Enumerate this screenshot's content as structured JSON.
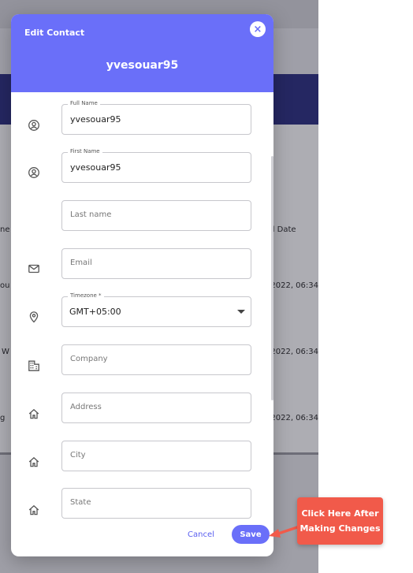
{
  "background": {
    "column_header": "ed Date",
    "col_left_1": "ne",
    "col_left_2": "ou",
    "col_left_3": "W",
    "col_left_4": "g",
    "rows": [
      "/2022, 06:34",
      "/2022, 06:34",
      "/2022, 06:34"
    ]
  },
  "modal": {
    "title": "Edit Contact",
    "contact_name": "yvesouar95",
    "close_symbol": "×"
  },
  "fields": {
    "full_name": {
      "label": "Full Name",
      "value": "yvesouar95"
    },
    "first_name": {
      "label": "First Name",
      "value": "yvesouar95"
    },
    "last_name": {
      "placeholder": "Last name"
    },
    "email": {
      "placeholder": "Email"
    },
    "timezone": {
      "label": "Timezone *",
      "value": "GMT+05:00"
    },
    "company": {
      "placeholder": "Company"
    },
    "address": {
      "placeholder": "Address"
    },
    "city": {
      "placeholder": "City"
    },
    "state": {
      "placeholder": "State"
    }
  },
  "actions": {
    "cancel_label": "Cancel",
    "save_label": "Save"
  },
  "callout": {
    "text": "Click Here After Making Changes"
  },
  "colors": {
    "accent": "#6a6ff9",
    "callout": "#f15a4a",
    "navbar": "#24277d"
  }
}
